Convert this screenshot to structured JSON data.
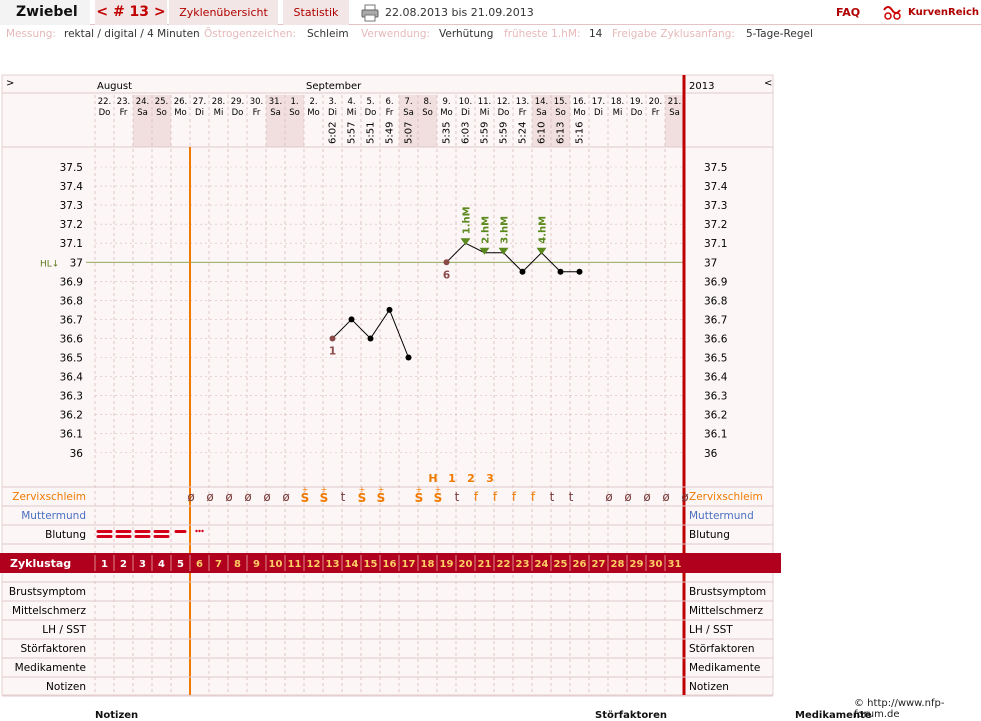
{
  "top": {
    "name": "Zwiebel",
    "cycle": "< # 13 >",
    "overview": "Zyklenübersicht",
    "stats": "Statistik",
    "range": "22.08.2013 bis 21.09.2013",
    "faq": "FAQ",
    "logo": "KurvenReich"
  },
  "info": [
    {
      "label": "Messung:",
      "value": "rektal / digital / 4 Minuten"
    },
    {
      "label": "Östrogenzeichen:",
      "value": "Schleim"
    },
    {
      "label": "Verwendung:",
      "value": "Verhütung"
    },
    {
      "label": "früheste 1.hM:",
      "value": "14"
    },
    {
      "label": "Freigabe Zyklusanfang:",
      "value": "5-Tage-Regel"
    }
  ],
  "nav": {
    "left": ">",
    "right": "<"
  },
  "year": "2013",
  "months": [
    {
      "label": "August",
      "col": 0
    },
    {
      "label": "September",
      "col": 11
    }
  ],
  "days": [
    {
      "d": "22.",
      "w": "Do"
    },
    {
      "d": "23.",
      "w": "Fr"
    },
    {
      "d": "24.",
      "w": "Sa"
    },
    {
      "d": "25.",
      "w": "So"
    },
    {
      "d": "26.",
      "w": "Mo"
    },
    {
      "d": "27.",
      "w": "Di"
    },
    {
      "d": "28.",
      "w": "Mi"
    },
    {
      "d": "29.",
      "w": "Do"
    },
    {
      "d": "30.",
      "w": "Fr"
    },
    {
      "d": "31.",
      "w": "Sa"
    },
    {
      "d": "1.",
      "w": "So"
    },
    {
      "d": "2.",
      "w": "Mo"
    },
    {
      "d": "3.",
      "w": "Di"
    },
    {
      "d": "4.",
      "w": "Mi"
    },
    {
      "d": "5.",
      "w": "Do"
    },
    {
      "d": "6.",
      "w": "Fr"
    },
    {
      "d": "7.",
      "w": "Sa"
    },
    {
      "d": "8.",
      "w": "So"
    },
    {
      "d": "9.",
      "w": "Mo"
    },
    {
      "d": "10.",
      "w": "Di"
    },
    {
      "d": "11.",
      "w": "Mi"
    },
    {
      "d": "12.",
      "w": "Do"
    },
    {
      "d": "13.",
      "w": "Fr"
    },
    {
      "d": "14.",
      "w": "Sa"
    },
    {
      "d": "15.",
      "w": "So"
    },
    {
      "d": "16.",
      "w": "Mo"
    },
    {
      "d": "17.",
      "w": "Di"
    },
    {
      "d": "18.",
      "w": "Mi"
    },
    {
      "d": "19.",
      "w": "Do"
    },
    {
      "d": "20.",
      "w": "Fr"
    },
    {
      "d": "21.",
      "w": "Sa"
    }
  ],
  "weekend_cols": [
    2,
    3,
    9,
    10,
    16,
    17,
    23,
    24,
    30
  ],
  "times": [
    "",
    "",
    "",
    "",
    "",
    "",
    "",
    "",
    "",
    "",
    "",
    "",
    "6:02",
    "5:57",
    "5:51",
    "5:49",
    "5:07",
    "",
    "5:35",
    "6:03",
    "5:59",
    "5:59",
    "5:24",
    "6:10",
    "6:13",
    "5:16",
    "",
    "",
    "",
    "",
    ""
  ],
  "y_ticks": [
    "37.5",
    "37.4",
    "37.3",
    "37.2",
    "37.1",
    "37",
    "36.9",
    "36.8",
    "36.7",
    "36.6",
    "36.5",
    "36.4",
    "36.3",
    "36.2",
    "36.1",
    "36"
  ],
  "hl_label": "HL↓",
  "hl_value": 37,
  "cycle_start_col": 5,
  "chart_data": {
    "type": "line",
    "x": [
      13,
      14,
      15,
      16,
      17,
      19,
      20,
      21,
      22,
      23,
      24,
      25,
      26
    ],
    "segments": [
      [
        13,
        14,
        15,
        16,
        17
      ],
      [
        19,
        20,
        21,
        22,
        23,
        24,
        25,
        26
      ]
    ],
    "values": [
      36.6,
      36.7,
      36.6,
      36.75,
      36.5,
      37.0,
      37.1,
      37.05,
      37.05,
      36.95,
      37.05,
      36.95,
      36.95
    ],
    "ylim": [
      36.0,
      37.5
    ],
    "hl": 37.0,
    "point_labels": [
      {
        "x": 13,
        "text": "1"
      },
      {
        "x": 19,
        "text": "6"
      }
    ],
    "hm_markers": [
      {
        "x": 20,
        "text": "1.hM"
      },
      {
        "x": 21,
        "text": "2.hM"
      },
      {
        "x": 22,
        "text": "3.hM"
      },
      {
        "x": 24,
        "text": "4.hM"
      }
    ]
  },
  "peak_labels": [
    {
      "col": 17,
      "text": "H"
    },
    {
      "col": 18,
      "text": "1"
    },
    {
      "col": 19,
      "text": "2"
    },
    {
      "col": 20,
      "text": "3"
    }
  ],
  "mucus": [
    "",
    "",
    "",
    "",
    "",
    "ø",
    "ø",
    "ø",
    "ø",
    "ø",
    "ø",
    "S+",
    "S+",
    "t",
    "S+",
    "S+",
    "",
    "S+",
    "S+",
    "t",
    "f",
    "f",
    "f",
    "f",
    "t",
    "t",
    "",
    "ø",
    "ø",
    "ø",
    "ø",
    "ø"
  ],
  "rows": {
    "zervix": "Zervixschleim",
    "muttermund": "Muttermund",
    "blutung": "Blutung",
    "zyklustag": "Zyklustag",
    "brust": "Brustsymptom",
    "mittel": "Mittelschmerz",
    "lh": "LH / SST",
    "stoer": "Störfaktoren",
    "medi": "Medikamente",
    "notizen": "Notizen"
  },
  "bleeding": [
    "heavy",
    "heavy",
    "heavy",
    "heavy",
    "medium",
    "spot"
  ],
  "cycle_days": [
    "1",
    "2",
    "3",
    "4",
    "5",
    "6",
    "7",
    "8",
    "9",
    "10",
    "11",
    "12",
    "13",
    "14",
    "15",
    "16",
    "17",
    "18",
    "19",
    "20",
    "21",
    "22",
    "23",
    "24",
    "25",
    "26",
    "27",
    "28",
    "29",
    "30",
    "31"
  ],
  "footer": {
    "credit": "© http://www.nfp-forum.de",
    "notizen": "Notizen",
    "stoer": "Störfaktoren",
    "medi": "Medikamente"
  },
  "colors": {
    "accent": "#b0001e",
    "orange": "#f07a00",
    "green": "#5a8a1e",
    "pink": "#e6b9b9",
    "grid": "#d9bcbc"
  }
}
